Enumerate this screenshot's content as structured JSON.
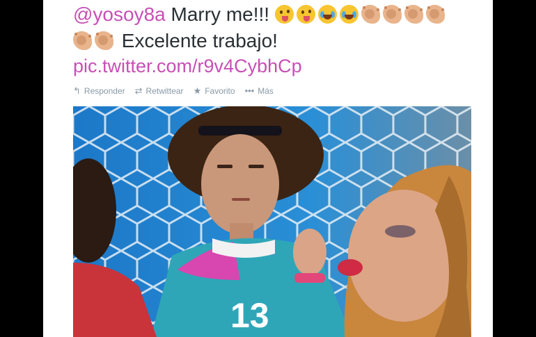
{
  "tweet": {
    "mention": "@yosoy8a",
    "line1_text": "Marry me!!!",
    "line2_text": "Excelente trabajo!",
    "link": "pic.twitter.com/r9v4CybhCp"
  },
  "emoji": {
    "line1": [
      "winking-face-with-tongue",
      "winking-face-with-tongue",
      "face-with-tears-of-joy",
      "face-with-tears-of-joy",
      "clapping-hands",
      "clapping-hands",
      "clapping-hands",
      "clapping-hands"
    ],
    "line2": [
      "clapping-hands",
      "clapping-hands"
    ]
  },
  "actions": {
    "reply": "Responder",
    "retweet": "Retwittear",
    "favorite": "Favorito",
    "more": "Más"
  },
  "colors": {
    "link_color": "#c74fb6",
    "action_gray": "#8899a6"
  },
  "photo": {
    "jersey_number": "13"
  }
}
